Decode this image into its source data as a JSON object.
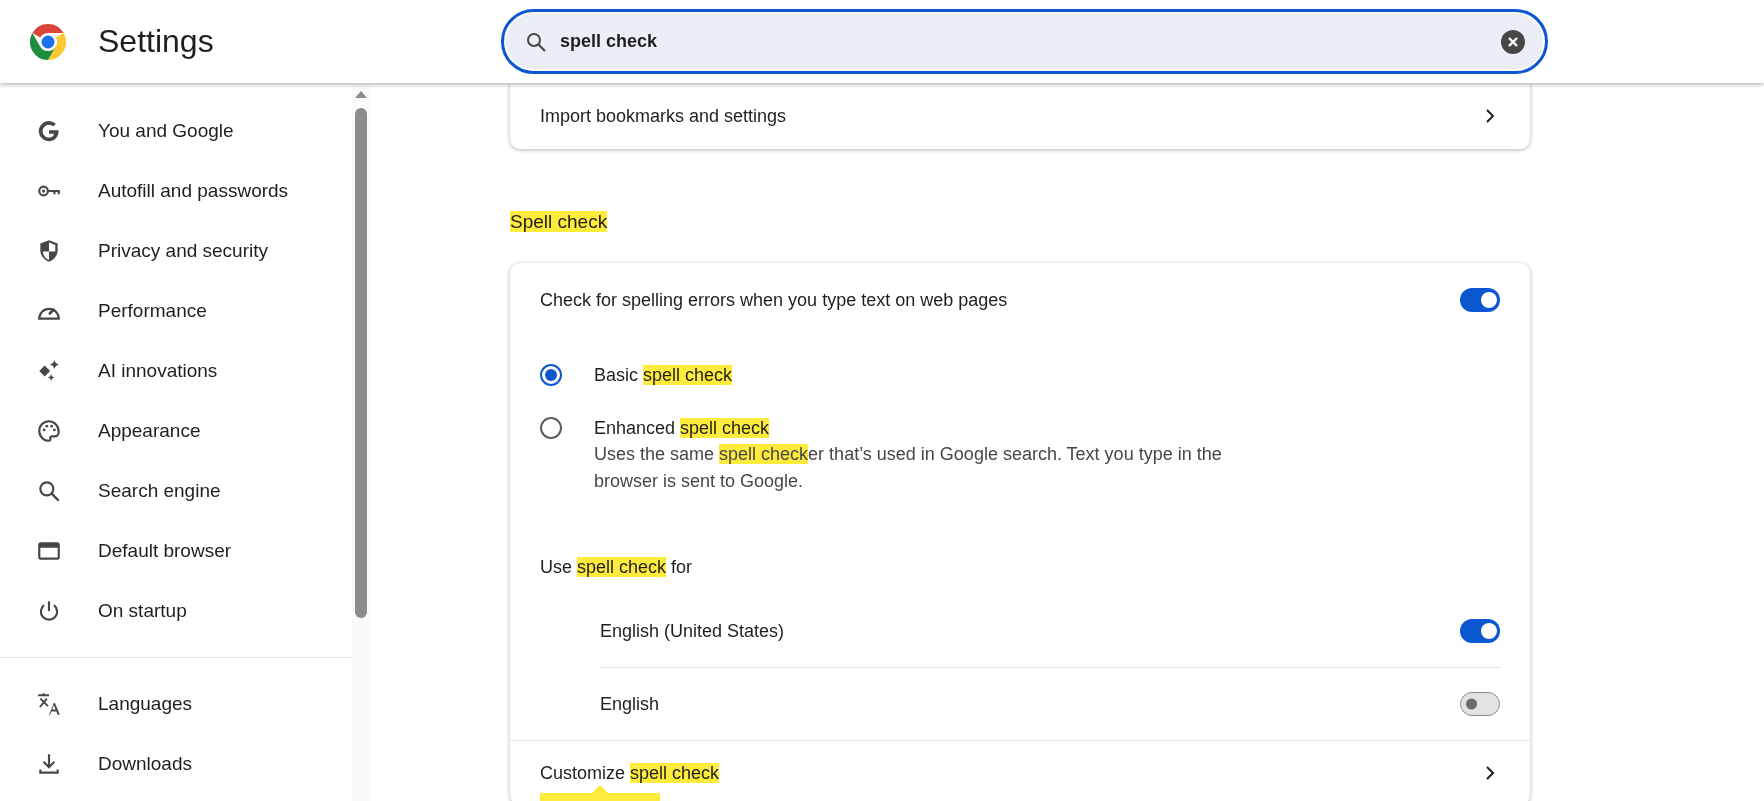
{
  "header": {
    "title": "Settings",
    "search": {
      "value": "spell check"
    }
  },
  "sidebar": {
    "groups": [
      {
        "items": [
          {
            "label": "You and Google",
            "selected": false
          },
          {
            "label": "Autofill and passwords",
            "selected": false
          },
          {
            "label": "Privacy and security",
            "selected": false
          },
          {
            "label": "Performance",
            "selected": false
          },
          {
            "label": "AI innovations",
            "selected": false
          },
          {
            "label": "Appearance",
            "selected": false
          },
          {
            "label": "Search engine",
            "selected": false
          },
          {
            "label": "Default browser",
            "selected": false
          },
          {
            "label": "On startup",
            "selected": false
          }
        ]
      },
      {
        "items": [
          {
            "label": "Languages",
            "selected": false
          },
          {
            "label": "Downloads",
            "selected": false
          }
        ]
      }
    ]
  },
  "import_card": {
    "label": "Import bookmarks and settings"
  },
  "section": {
    "title": [
      {
        "text": "Spell check",
        "highlighted": true
      }
    ],
    "master": {
      "label": [
        {
          "text": "Check for spelling errors when you type text on web pages",
          "highlighted": false
        }
      ],
      "on": true
    },
    "options": [
      {
        "label": [
          {
            "text": "Basic ",
            "highlighted": false
          },
          {
            "text": "spell check",
            "highlighted": true
          }
        ],
        "selected": true
      },
      {
        "label": [
          {
            "text": "Enhanced ",
            "highlighted": false
          },
          {
            "text": "spell check",
            "highlighted": true
          }
        ],
        "description": [
          {
            "text": "Uses the same ",
            "highlighted": false
          },
          {
            "text": "spell check",
            "highlighted": true
          },
          {
            "text": "er that’s used in Google search. Text you type in the browser is sent to Google.",
            "highlighted": false
          }
        ],
        "selected": false
      }
    ],
    "languages_heading": [
      {
        "text": "Use ",
        "highlighted": false
      },
      {
        "text": "spell check",
        "highlighted": true
      },
      {
        "text": " for",
        "highlighted": false
      }
    ],
    "languages": [
      {
        "label": "English (United States)",
        "on": true
      },
      {
        "label": "English",
        "on": false
      }
    ],
    "customize": {
      "label": [
        {
          "text": "Customize ",
          "highlighted": false
        },
        {
          "text": "spell check",
          "highlighted": true
        }
      ]
    }
  }
}
